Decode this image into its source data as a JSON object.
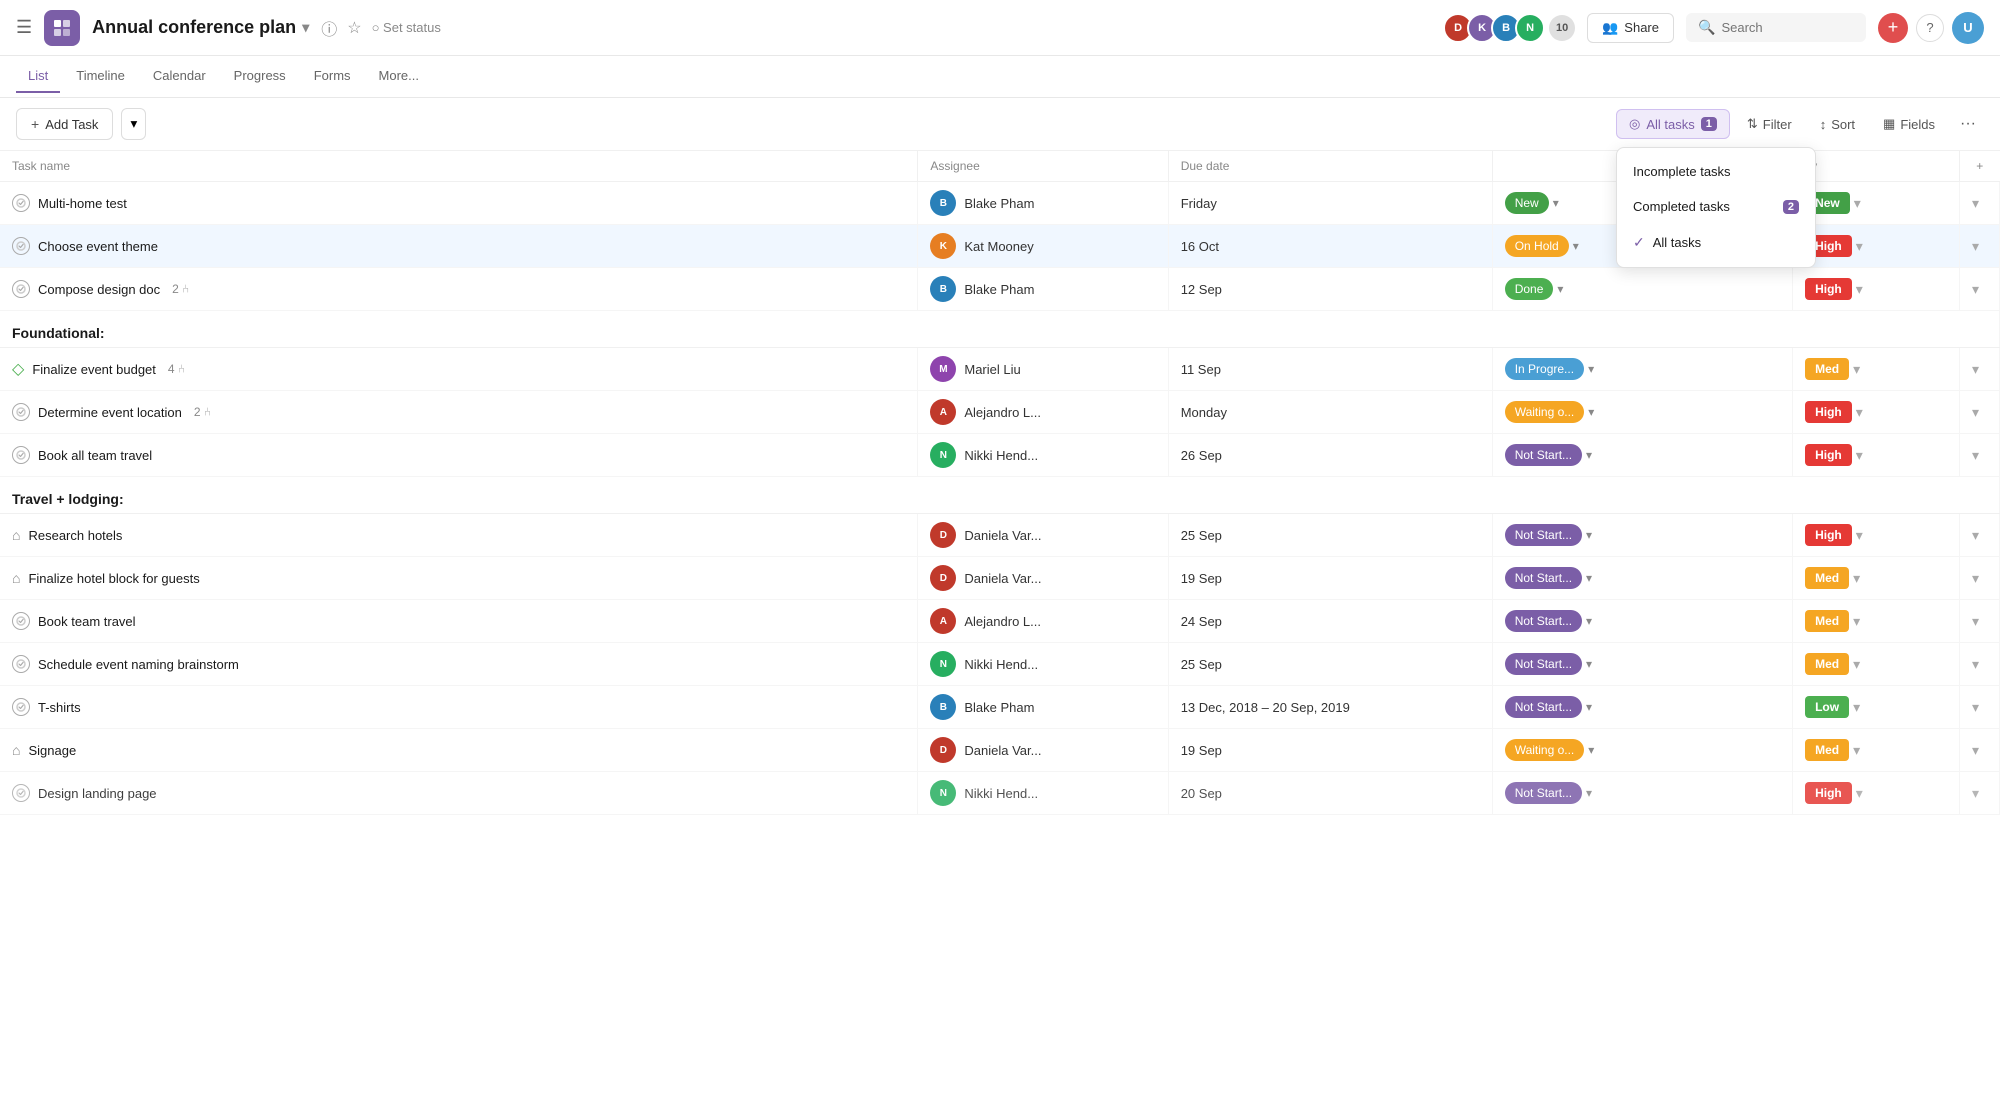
{
  "header": {
    "hamburger": "☰",
    "app_icon": "▦",
    "project_title": "Annual conference plan",
    "arrow": "▾",
    "info_icon": "ⓘ",
    "star_icon": "☆",
    "set_status": "○ Set status",
    "share_label": "Share",
    "search_placeholder": "Search",
    "plus_icon": "+",
    "help_icon": "?",
    "avatar_count": "10"
  },
  "subnav": {
    "items": [
      {
        "label": "List",
        "active": true
      },
      {
        "label": "Timeline",
        "active": false
      },
      {
        "label": "Calendar",
        "active": false
      },
      {
        "label": "Progress",
        "active": false
      },
      {
        "label": "Forms",
        "active": false
      },
      {
        "label": "More...",
        "active": false
      }
    ]
  },
  "toolbar": {
    "add_task_label": "+ Add Task",
    "all_tasks_label": "All tasks",
    "badge": "1",
    "filter_label": "Filter",
    "sort_label": "Sort",
    "fields_label": "Fields",
    "more": "···"
  },
  "dropdown": {
    "items": [
      {
        "label": "Incomplete tasks",
        "checked": false,
        "badge": null
      },
      {
        "label": "Completed tasks",
        "checked": false,
        "badge": "2"
      },
      {
        "label": "All tasks",
        "checked": true,
        "badge": null
      }
    ]
  },
  "table": {
    "columns": {
      "task_name": "Task name",
      "assignee": "Assignee",
      "due_date": "Due date",
      "status": "",
      "priority": "ity",
      "add": "+"
    },
    "rows": [
      {
        "type": "task",
        "name": "Multi-home test",
        "icon": "check",
        "subtasks": "",
        "assignee": "Blake Pham",
        "due_date": "Friday",
        "status": "new",
        "status_label": "New",
        "priority": "new",
        "priority_label": "New",
        "selected": false
      },
      {
        "type": "task",
        "name": "Choose event theme",
        "icon": "check",
        "subtasks": "",
        "assignee": "Kat Mooney",
        "due_date": "16 Oct",
        "status": "on-hold",
        "status_label": "On Hold",
        "priority": "high",
        "priority_label": "High",
        "selected": true
      },
      {
        "type": "task",
        "name": "Compose design doc",
        "icon": "check",
        "subtasks": "2",
        "assignee": "Blake Pham",
        "due_date": "12 Sep",
        "status": "done",
        "status_label": "Done",
        "priority": "high",
        "priority_label": "High",
        "selected": false
      },
      {
        "type": "section",
        "label": "Foundational:"
      },
      {
        "type": "task",
        "name": "Finalize event budget",
        "icon": "diamond",
        "subtasks": "4",
        "assignee": "Mariel Liu",
        "due_date": "11 Sep",
        "status": "in-progress",
        "status_label": "In Progre...",
        "priority": "med",
        "priority_label": "Med",
        "selected": false
      },
      {
        "type": "task",
        "name": "Determine event location",
        "icon": "check",
        "subtasks": "2",
        "assignee": "Alejandro L...",
        "due_date": "Monday",
        "status": "waiting",
        "status_label": "Waiting o...",
        "priority": "high",
        "priority_label": "High",
        "selected": false
      },
      {
        "type": "task",
        "name": "Book all team travel",
        "icon": "check",
        "subtasks": "",
        "assignee": "Nikki Hend...",
        "due_date": "26 Sep",
        "status": "not-started",
        "status_label": "Not Start...",
        "priority": "high",
        "priority_label": "High",
        "selected": false
      },
      {
        "type": "section",
        "label": "Travel + lodging:"
      },
      {
        "type": "task",
        "name": "Research hotels",
        "icon": "hotel",
        "subtasks": "",
        "assignee": "Daniela Var...",
        "due_date": "25 Sep",
        "status": "not-started",
        "status_label": "Not Start...",
        "priority": "high",
        "priority_label": "High",
        "selected": false
      },
      {
        "type": "task",
        "name": "Finalize hotel block for guests",
        "icon": "hotel",
        "subtasks": "",
        "assignee": "Daniela Var...",
        "due_date": "19 Sep",
        "status": "not-started",
        "status_label": "Not Start...",
        "priority": "med",
        "priority_label": "Med",
        "selected": false
      },
      {
        "type": "task",
        "name": "Book team travel",
        "icon": "check",
        "subtasks": "",
        "assignee": "Alejandro L...",
        "due_date": "24 Sep",
        "status": "not-started",
        "status_label": "Not Start...",
        "priority": "med",
        "priority_label": "Med",
        "selected": false
      },
      {
        "type": "task",
        "name": "Schedule event naming brainstorm",
        "icon": "check",
        "subtasks": "",
        "assignee": "Nikki Hend...",
        "due_date": "25 Sep",
        "status": "not-started",
        "status_label": "Not Start...",
        "priority": "med",
        "priority_label": "Med",
        "selected": false
      },
      {
        "type": "task",
        "name": "T-shirts",
        "icon": "check",
        "subtasks": "",
        "assignee": "Blake Pham",
        "due_date": "13 Dec, 2018 – 20 Sep, 2019",
        "status": "not-started",
        "status_label": "Not Start...",
        "priority": "low",
        "priority_label": "Low",
        "selected": false
      },
      {
        "type": "task",
        "name": "Signage",
        "icon": "hotel",
        "subtasks": "",
        "assignee": "Daniela Var...",
        "due_date": "19 Sep",
        "status": "waiting",
        "status_label": "Waiting o...",
        "priority": "med",
        "priority_label": "Med",
        "selected": false
      },
      {
        "type": "task",
        "name": "Design landing page",
        "icon": "check",
        "subtasks": "",
        "assignee": "Nikki Hend...",
        "due_date": "20 Sep",
        "status": "not-started",
        "status_label": "Not Start...",
        "priority": "high",
        "priority_label": "High",
        "selected": false,
        "partial": true
      }
    ]
  },
  "avatars": [
    {
      "color": "#c0392b",
      "initials": "D"
    },
    {
      "color": "#7b5ea7",
      "initials": "K"
    },
    {
      "color": "#2980b9",
      "initials": "B"
    },
    {
      "color": "#27ae60",
      "initials": "N"
    }
  ],
  "assignee_colors": {
    "Blake Pham": "#2980b9",
    "Kat Mooney": "#e67e22",
    "Mariel Liu": "#8e44ad",
    "Alejandro L...": "#c0392b",
    "Nikki Hend...": "#27ae60",
    "Daniela Var...": "#c0392b"
  }
}
